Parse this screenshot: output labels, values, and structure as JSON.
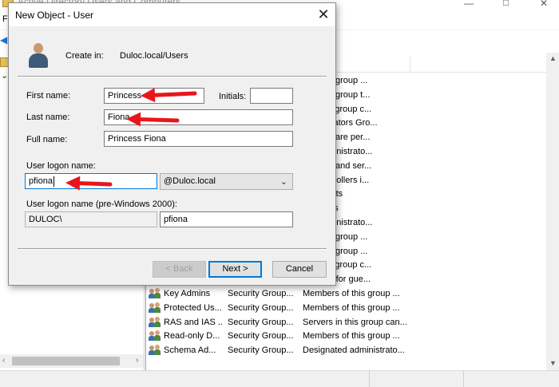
{
  "background_window": {
    "title": "Active Directory Users and Computers",
    "menu_first_letter": "F"
  },
  "list": {
    "header_description": "ion",
    "rows": [
      {
        "name": "",
        "type": "",
        "description": "s of this group ..."
      },
      {
        "name": "",
        "type": "",
        "description": "s of this group t..."
      },
      {
        "name": "",
        "type": "",
        "description": "s in this group c..."
      },
      {
        "name": "",
        "type": "",
        "description": "dministrators Gro..."
      },
      {
        "name": "",
        "type": "",
        "description": "nts who are per..."
      },
      {
        "name": "",
        "type": "",
        "description": "ted administrato..."
      },
      {
        "name": "",
        "type": "",
        "description": "stations and ser..."
      },
      {
        "name": "",
        "type": "",
        "description": "ain controllers i..."
      },
      {
        "name": "",
        "type": "",
        "description": "ain guests"
      },
      {
        "name": "",
        "type": "",
        "description": "ain users"
      },
      {
        "name": "",
        "type": "",
        "description": "ted administrato..."
      },
      {
        "name": "",
        "type": "",
        "description": "s of this group ..."
      },
      {
        "name": "",
        "type": "",
        "description": "s of this group ..."
      },
      {
        "name": "",
        "type": "",
        "description": "s in this group c..."
      },
      {
        "name": "",
        "type": "",
        "description": "account for gue..."
      },
      {
        "name": "Key Admins",
        "type": "Security Group...",
        "description": "Members of this group ..."
      },
      {
        "name": "Protected Us...",
        "type": "Security Group...",
        "description": "Members of this group ..."
      },
      {
        "name": "RAS and IAS ...",
        "type": "Security Group...",
        "description": "Servers in this group can..."
      },
      {
        "name": "Read-only D...",
        "type": "Security Group...",
        "description": "Members of this group ..."
      },
      {
        "name": "Schema Ad...",
        "type": "Security Group...",
        "description": "Designated administrato..."
      }
    ]
  },
  "dialog": {
    "title": "New Object - User",
    "close_glyph": "✕",
    "create_in_label": "Create in:",
    "create_in_value": "Duloc.local/Users",
    "first_name_label": "First name:",
    "first_name_value": "Princess",
    "initials_label": "Initials:",
    "initials_value": "",
    "last_name_label": "Last name:",
    "last_name_value": "Fiona",
    "full_name_label": "Full name:",
    "full_name_value": "Princess Fiona",
    "logon_name_label": "User logon name:",
    "logon_name_value": "pfiona",
    "domain_suffix": "@Duloc.local",
    "pre2000_label": "User logon name (pre-Windows 2000):",
    "pre2000_domain": "DULOC\\",
    "pre2000_name": "pfiona",
    "back_button": "< Back",
    "next_button": "Next >",
    "cancel_button": "Cancel"
  },
  "annotations": {
    "arrow_color": "#e8161b"
  }
}
